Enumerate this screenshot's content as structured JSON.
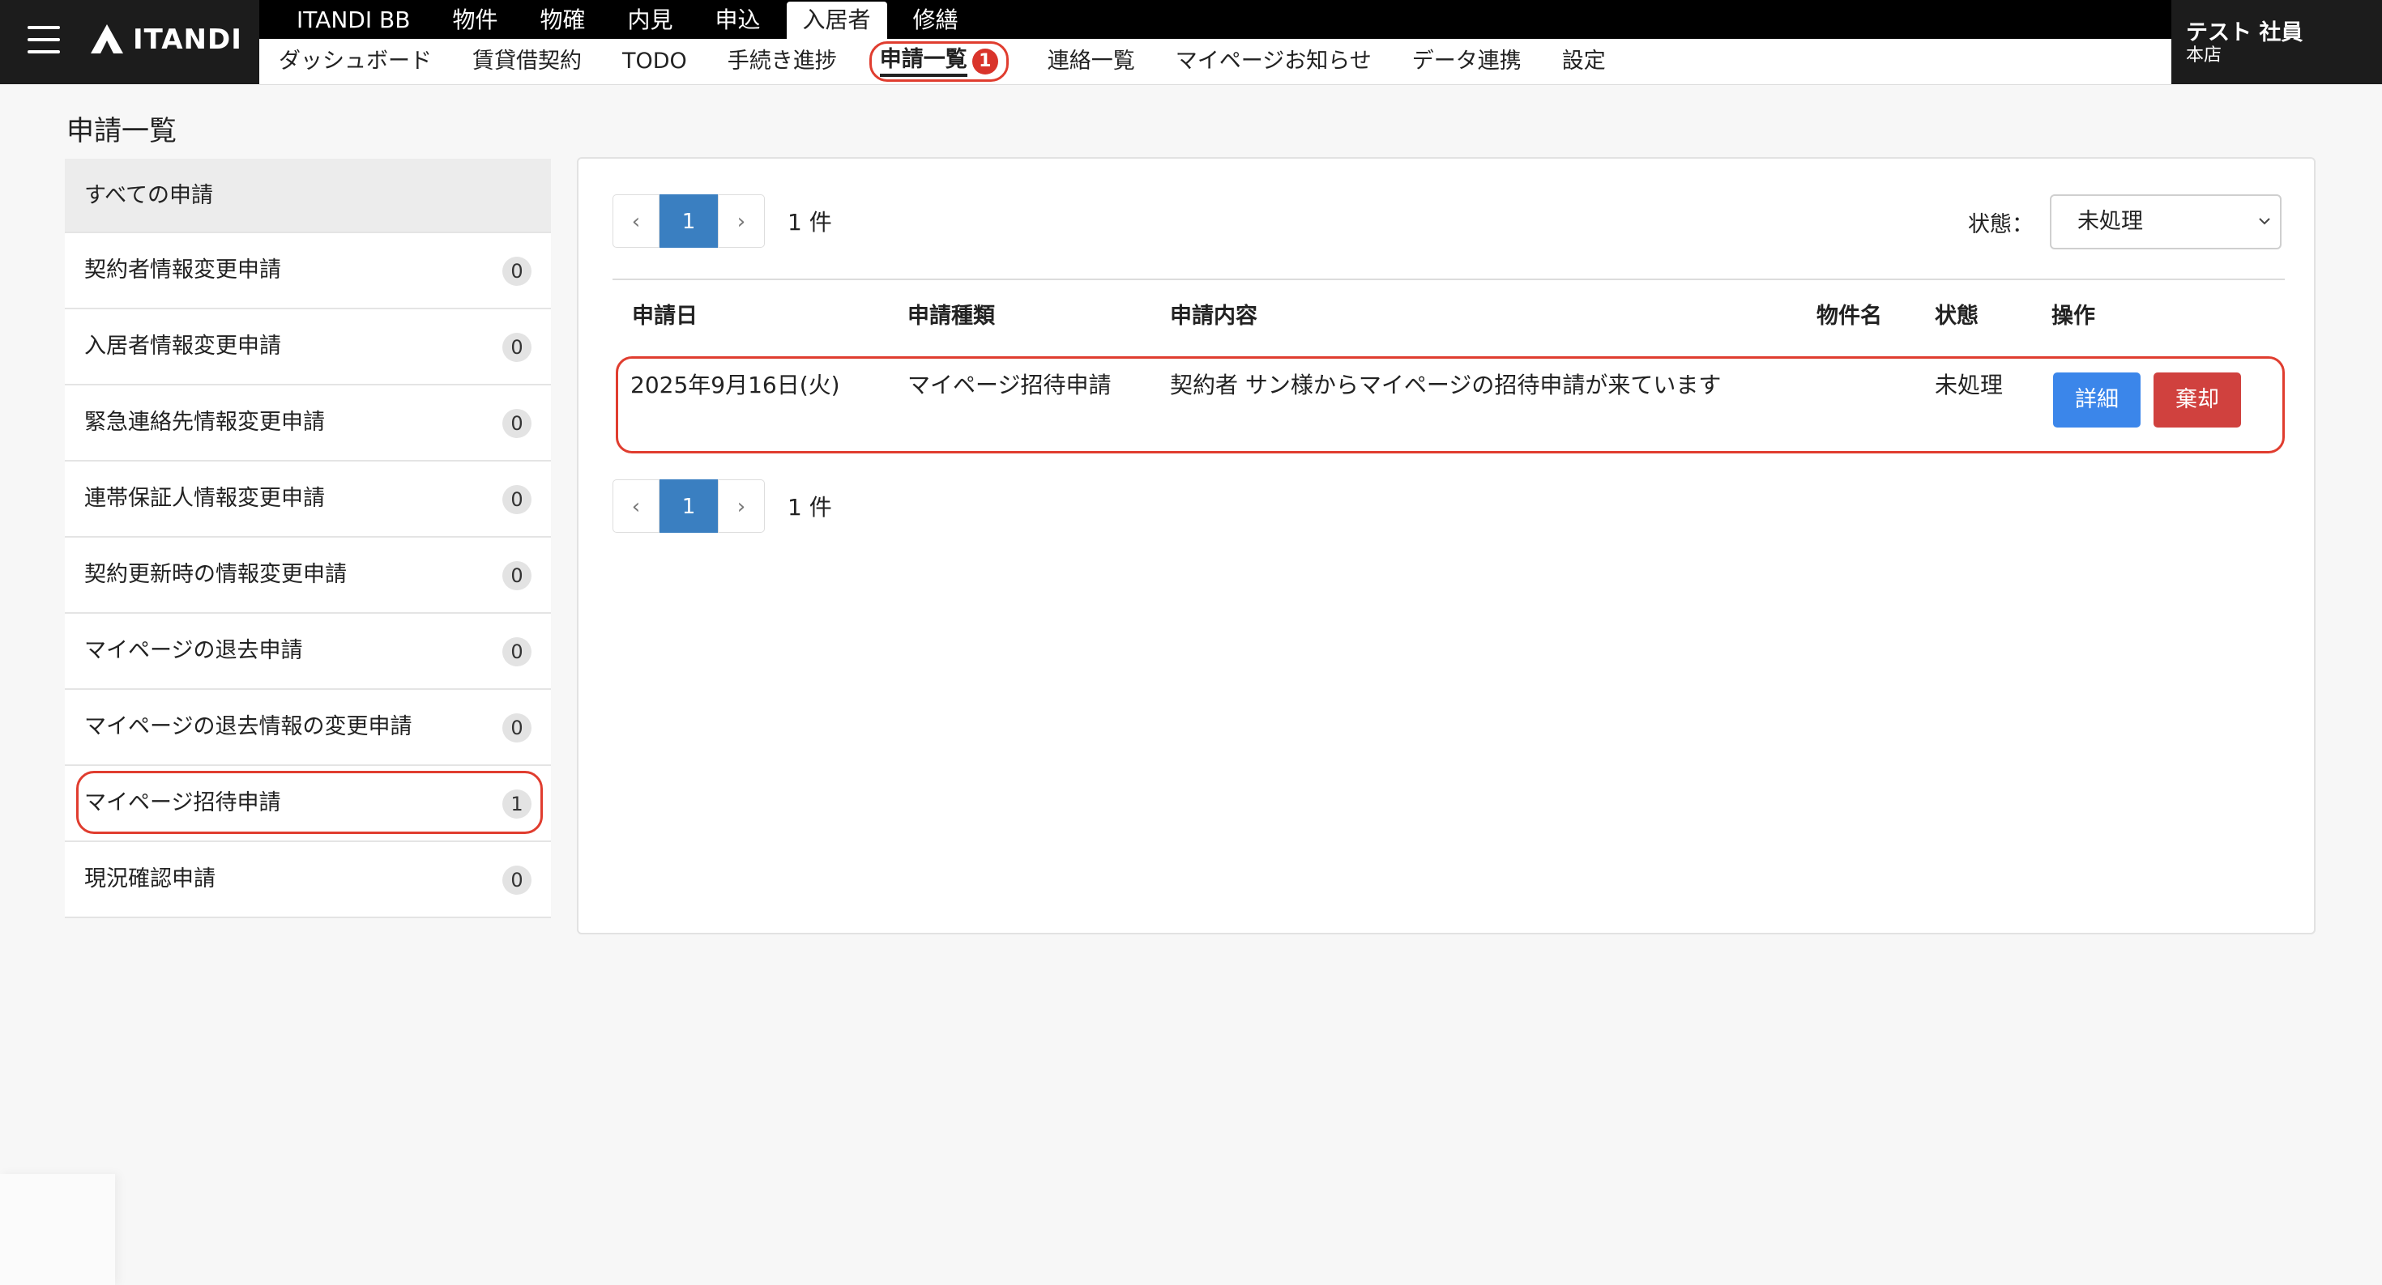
{
  "app": {
    "logo_text": "ITANDI"
  },
  "main_nav": [
    {
      "label": "ITANDI BB",
      "active": false
    },
    {
      "label": "物件",
      "active": false
    },
    {
      "label": "物確",
      "active": false
    },
    {
      "label": "内見",
      "active": false
    },
    {
      "label": "申込",
      "active": false
    },
    {
      "label": "入居者",
      "active": true
    },
    {
      "label": "修繕",
      "active": false
    }
  ],
  "sub_nav": [
    {
      "label": "ダッシュボード"
    },
    {
      "label": "賃貸借契約"
    },
    {
      "label": "TODO"
    },
    {
      "label": "手続き進捗"
    },
    {
      "label": "申請一覧",
      "badge": "1",
      "active": true
    },
    {
      "label": "連絡一覧"
    },
    {
      "label": "マイページお知らせ"
    },
    {
      "label": "データ連携"
    },
    {
      "label": "設定"
    }
  ],
  "user": {
    "name": "テスト 社員",
    "branch": "本店"
  },
  "page": {
    "title": "申請一覧"
  },
  "sidebar": {
    "all_label": "すべての申請",
    "items": [
      {
        "label": "契約者情報変更申請",
        "count": "0"
      },
      {
        "label": "入居者情報変更申請",
        "count": "0"
      },
      {
        "label": "緊急連絡先情報変更申請",
        "count": "0"
      },
      {
        "label": "連帯保証人情報変更申請",
        "count": "0"
      },
      {
        "label": "契約更新時の情報変更申請",
        "count": "0"
      },
      {
        "label": "マイページの退去申請",
        "count": "0"
      },
      {
        "label": "マイページの退去情報の変更申請",
        "count": "0"
      },
      {
        "label": "マイページ招待申請",
        "count": "1"
      },
      {
        "label": "現況確認申請",
        "count": "0"
      }
    ]
  },
  "pagination": {
    "prev": "‹",
    "current": "1",
    "next": "›",
    "count_text": "1 件"
  },
  "filter": {
    "label": "状態：",
    "value": "未処理"
  },
  "table": {
    "headers": [
      "申請日",
      "申請種類",
      "申請内容",
      "物件名",
      "状態",
      "操作"
    ],
    "rows": [
      {
        "date": "2025年9月16日(火)",
        "type": "マイページ招待申請",
        "content": "契約者 サン様からマイページの招待申請が来ています",
        "property": "",
        "status": "未処理",
        "detail_label": "詳細",
        "reject_label": "棄却"
      }
    ]
  },
  "colors": {
    "accent": "#3a7fc1",
    "detail": "#3b86ea",
    "reject": "#d0413e",
    "highlight": "#e03d2f"
  }
}
